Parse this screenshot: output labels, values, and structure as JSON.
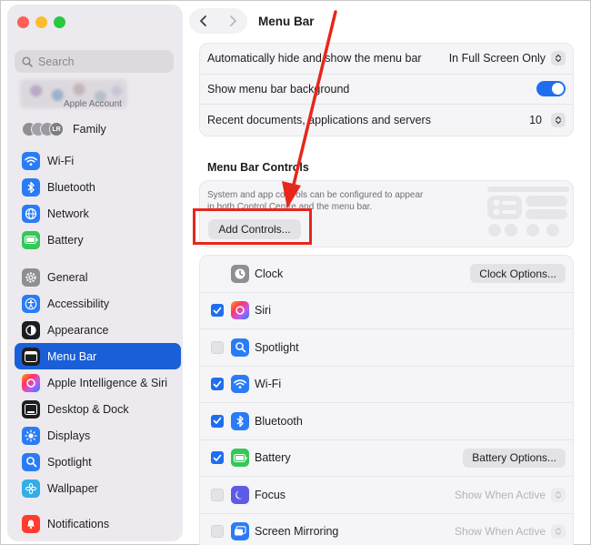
{
  "window": {
    "title": "Menu Bar"
  },
  "colors": {
    "accent": "#1a5fd7",
    "highlight": "#e8261b"
  },
  "sidebar": {
    "search_placeholder": "Search",
    "account_subtitle": "Apple Account",
    "family_label": "Family",
    "family_initials": "LR",
    "items": [
      {
        "label": "Wi-Fi",
        "icon": "wifi-icon"
      },
      {
        "label": "Bluetooth",
        "icon": "bluetooth-icon"
      },
      {
        "label": "Network",
        "icon": "globe-icon"
      },
      {
        "label": "Battery",
        "icon": "battery-icon"
      },
      {
        "label": "General",
        "icon": "gear-icon"
      },
      {
        "label": "Accessibility",
        "icon": "accessibility-icon"
      },
      {
        "label": "Appearance",
        "icon": "appearance-icon"
      },
      {
        "label": "Menu Bar",
        "icon": "menu-bar-icon",
        "selected": true
      },
      {
        "label": "Apple Intelligence & Siri",
        "icon": "siri-icon"
      },
      {
        "label": "Desktop & Dock",
        "icon": "dock-icon"
      },
      {
        "label": "Displays",
        "icon": "sun-icon"
      },
      {
        "label": "Spotlight",
        "icon": "magnifier-icon"
      },
      {
        "label": "Wallpaper",
        "icon": "flower-icon"
      },
      {
        "label": "Notifications",
        "icon": "bell-icon"
      }
    ]
  },
  "settings": {
    "auto_hide_label": "Automatically hide and show the menu bar",
    "auto_hide_value": "In Full Screen Only",
    "background_label": "Show menu bar background",
    "background_on": true,
    "recent_label": "Recent documents, applications and servers",
    "recent_value": "10"
  },
  "controls": {
    "section_title": "Menu Bar Controls",
    "info_text": "System and app controls can be configured to appear in both Control Centre and the menu bar.",
    "add_button": "Add Controls...",
    "items": [
      {
        "label": "Clock",
        "checked": null,
        "button": "Clock Options..."
      },
      {
        "label": "Siri",
        "checked": true
      },
      {
        "label": "Spotlight",
        "checked": false
      },
      {
        "label": "Wi-Fi",
        "checked": true
      },
      {
        "label": "Bluetooth",
        "checked": true
      },
      {
        "label": "Battery",
        "checked": true,
        "button": "Battery Options..."
      },
      {
        "label": "Focus",
        "checked": false,
        "popup": "Show When Active"
      },
      {
        "label": "Screen Mirroring",
        "checked": false,
        "popup": "Show When Active"
      }
    ]
  }
}
